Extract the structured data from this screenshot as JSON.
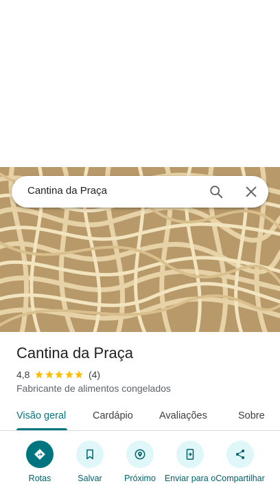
{
  "search": {
    "query": "Cantina da Praça"
  },
  "place": {
    "name": "Cantina da Praça",
    "rating": "4,8",
    "stars": 5,
    "review_count": "(4)",
    "category": "Fabricante de alimentos congelados"
  },
  "tabs": [
    {
      "label": "Visão geral",
      "active": true
    },
    {
      "label": "Cardápio",
      "active": false
    },
    {
      "label": "Avaliações",
      "active": false
    },
    {
      "label": "Sobre",
      "active": false
    }
  ],
  "actions": [
    {
      "label": "Rotas",
      "icon": "directions-icon"
    },
    {
      "label": "Salvar",
      "icon": "bookmark-icon"
    },
    {
      "label": "Próximo",
      "icon": "nearby-icon"
    },
    {
      "label": "Enviar para o",
      "icon": "send-to-phone-icon"
    },
    {
      "label": "Compartilhar",
      "icon": "share-icon"
    }
  ],
  "colors": {
    "accent": "#00757f",
    "action_bg": "#e0f7fa",
    "star": "#fbbc04"
  }
}
